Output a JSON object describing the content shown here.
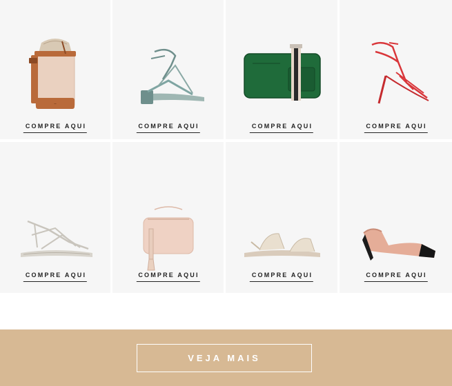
{
  "products": [
    {
      "name": "bucket bag",
      "cta": "COMPRE AQUI"
    },
    {
      "name": "strappy block heel sandal",
      "cta": "COMPRE AQUI"
    },
    {
      "name": "green crossbody bag",
      "cta": "COMPRE AQUI"
    },
    {
      "name": "red strappy heel sandal",
      "cta": "COMPRE AQUI"
    },
    {
      "name": "lace-up flat sandal",
      "cta": "COMPRE AQUI"
    },
    {
      "name": "woven crossbody bag with tassel",
      "cta": "COMPRE AQUI"
    },
    {
      "name": "metallic flat sandal",
      "cta": "COMPRE AQUI"
    },
    {
      "name": "two-tone slingback heel",
      "cta": "COMPRE AQUI"
    }
  ],
  "footer": {
    "button_label": "VEJA MAIS",
    "background_color": "#d7b994"
  }
}
